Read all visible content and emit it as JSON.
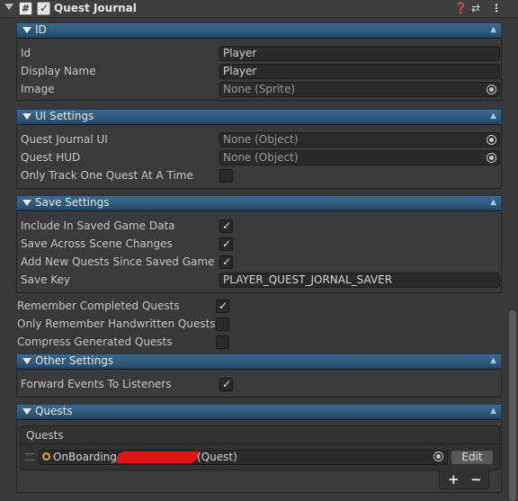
{
  "component": {
    "title": "Quest Journal",
    "enabled": true,
    "icons": [
      "help-icon",
      "preset-icon",
      "more-icon"
    ]
  },
  "sections": {
    "id": {
      "title": "ID",
      "id_label": "Id",
      "id_value": "Player",
      "display_name_label": "Display Name",
      "display_name_value": "Player",
      "image_label": "Image",
      "image_value": "None (Sprite)"
    },
    "ui_settings": {
      "title": "UI Settings",
      "journal_ui_label": "Quest Journal UI",
      "journal_ui_value": "None (Object)",
      "hud_label": "Quest HUD",
      "hud_value": "None (Object)",
      "track_one_label": "Only Track One Quest At A Time",
      "track_one_checked": false
    },
    "save_settings": {
      "title": "Save Settings",
      "include_label": "Include In Saved Game Data",
      "include_checked": true,
      "across_label": "Save Across Scene Changes",
      "across_checked": true,
      "add_new_label": "Add New Quests Since Saved Game",
      "add_new_checked": true,
      "save_key_label": "Save Key",
      "save_key_value": "PLAYER_QUEST_JORNAL_SAVER"
    },
    "outer": {
      "remember_label": "Remember Completed Quests",
      "remember_checked": true,
      "handwritten_label": "Only Remember Handwritten Quests",
      "handwritten_checked": false,
      "compress_label": "Compress Generated Quests",
      "compress_checked": false
    },
    "other_settings": {
      "title": "Other Settings",
      "forward_label": "Forward Events To Listeners",
      "forward_checked": true
    },
    "quests": {
      "title": "Quests",
      "list_label": "Quests",
      "item_name": "OnBoarding",
      "item_type": "(Quest)",
      "edit_label": "Edit",
      "add_label": "+",
      "remove_label": "−"
    }
  }
}
